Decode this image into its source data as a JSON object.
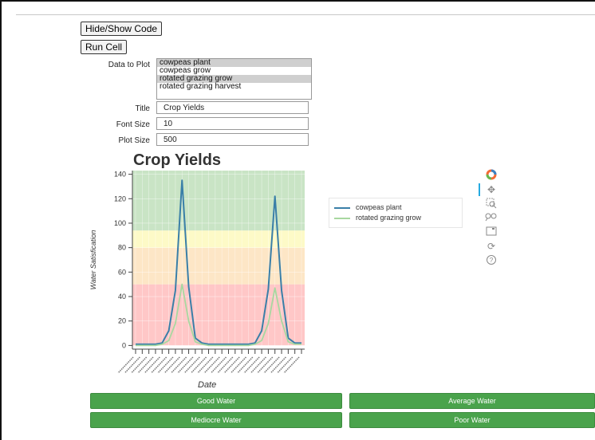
{
  "buttons": {
    "hide_show": "Hide/Show Code",
    "run_cell": "Run Cell"
  },
  "form": {
    "data_label": "Data to Plot",
    "options": [
      {
        "label": "cowpeas plant",
        "selected": true
      },
      {
        "label": "cowpeas grow",
        "selected": false
      },
      {
        "label": "rotated grazing grow",
        "selected": true
      },
      {
        "label": "rotated grazing harvest",
        "selected": false
      }
    ],
    "title_label": "Title",
    "title_value": "Crop Yields",
    "font_size_label": "Font Size",
    "font_size_value": "10",
    "plot_size_label": "Plot Size",
    "plot_size_value": "500"
  },
  "toolbar": {
    "icons": [
      "bokeh-logo-icon",
      "pan-icon",
      "box-zoom-icon",
      "wheel-zoom-icon",
      "save-icon",
      "reset-icon",
      "help-icon"
    ]
  },
  "water_buttons": [
    "Good Water",
    "Average Water",
    "Mediocre Water",
    "Poor Water"
  ],
  "chart_data": {
    "type": "line",
    "title": "Crop Yields",
    "xlabel": "Date",
    "ylabel": "Water Satisfication",
    "ylim": [
      -3,
      143
    ],
    "yticks": [
      0,
      20,
      40,
      60,
      80,
      100,
      120,
      140
    ],
    "bands": [
      {
        "from": 0,
        "to": 50,
        "color": "#ffc7c7"
      },
      {
        "from": 50,
        "to": 80,
        "color": "#fde6c6"
      },
      {
        "from": 80,
        "to": 94,
        "color": "#fdfac7"
      },
      {
        "from": 94,
        "to": 143,
        "color": "#c9e4c5"
      }
    ],
    "x": [
      0,
      1,
      2,
      3,
      4,
      5,
      6,
      7,
      8,
      9,
      10,
      11,
      12,
      13,
      14,
      15,
      16,
      17,
      18,
      19,
      20,
      21,
      22,
      23,
      24,
      25
    ],
    "series": [
      {
        "name": "cowpeas plant",
        "color": "#3a7fa8",
        "values": [
          1,
          1,
          1,
          1,
          2,
          12,
          45,
          135,
          48,
          6,
          2,
          1,
          1,
          1,
          1,
          1,
          1,
          1,
          2,
          12,
          46,
          122,
          45,
          6,
          2,
          2
        ]
      },
      {
        "name": "rotated grazing grow",
        "color": "#a8d8a0",
        "values": [
          0,
          0,
          0,
          0,
          1,
          4,
          18,
          50,
          20,
          3,
          1,
          0,
          0,
          0,
          0,
          0,
          0,
          0,
          1,
          4,
          18,
          47,
          20,
          3,
          1,
          1
        ]
      }
    ],
    "legend_position": "top-right",
    "grid": true
  }
}
